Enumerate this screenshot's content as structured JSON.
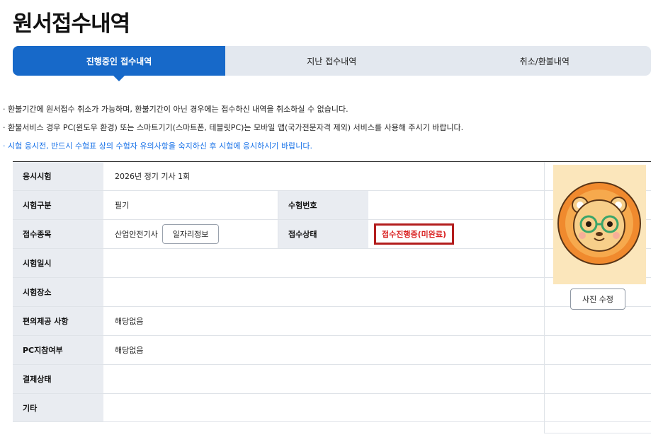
{
  "page": {
    "title": "원서접수내역"
  },
  "tabs": [
    {
      "label": "진행중인 접수내역",
      "active": true
    },
    {
      "label": "지난 접수내역",
      "active": false
    },
    {
      "label": "취소/환불내역",
      "active": false
    }
  ],
  "notices": [
    "· 환불기간에 원서접수 취소가 가능하며, 환불기간이 아닌 경우에는 접수하신 내역을 취소하실 수 없습니다.",
    "· 환불서비스 경우 PC(윈도우 환경) 또는 스마트기기(스마트폰, 테블릿PC)는 모바일 앱(국가전문자격 제외) 서비스를 사용해 주시기 바랍니다.",
    "· 시험 응시전, 반드시 수험표 상의 수험자 유의사항을 숙지하신 후 시험에 응시하시기 바랍니다."
  ],
  "info": {
    "exam_label": "응시시험",
    "exam_value": "2026년 정기 기사 1회",
    "type_label": "시험구분",
    "type_value": "필기",
    "number_label": "수험번호",
    "number_value": "",
    "subject_label": "접수종목",
    "subject_value": "산업안전기사",
    "job_button": "일자리정보",
    "status_label": "접수상태",
    "status_value": "접수진행중(미완료)",
    "date_label": "시험일시",
    "date_value": "",
    "place_label": "시험장소",
    "place_value": "",
    "convenience_label": "편의제공 사항",
    "convenience_value": "해당없음",
    "pc_label": "PC지참여부",
    "pc_value": "해당없음",
    "payment_label": "결제상태",
    "payment_value": "",
    "etc_label": "기타",
    "etc_value": ""
  },
  "photo": {
    "edit_button": "사진 수정"
  },
  "colors": {
    "accent": "#1769c9",
    "status_red": "#d92020",
    "header_bg": "#e9ecf1"
  }
}
